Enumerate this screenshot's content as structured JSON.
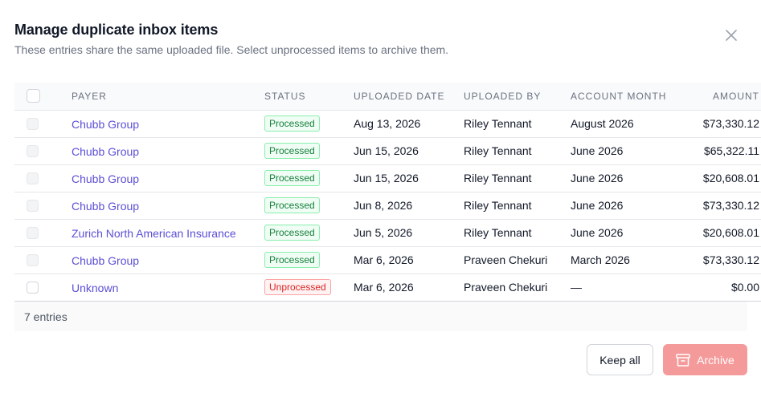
{
  "dialog": {
    "title": "Manage duplicate inbox items",
    "subtitle": "These entries share the same uploaded file. Select unprocessed items to archive them.",
    "close_icon": "close-icon"
  },
  "table": {
    "columns": [
      "PAYER",
      "STATUS",
      "UPLOADED DATE",
      "UPLOADED BY",
      "ACCOUNT MONTH",
      "AMOUNT"
    ],
    "rows": [
      {
        "payer": "Chubb Group",
        "status": "Processed",
        "status_type": "processed",
        "date": "Aug 13, 2026",
        "by": "Riley Tennant",
        "month": "August 2026",
        "amount": "$73,330.12"
      },
      {
        "payer": "Chubb Group",
        "status": "Processed",
        "status_type": "processed",
        "date": "Jun 15, 2026",
        "by": "Riley Tennant",
        "month": "June 2026",
        "amount": "$65,322.11"
      },
      {
        "payer": "Chubb Group",
        "status": "Processed",
        "status_type": "processed",
        "date": "Jun 15, 2026",
        "by": "Riley Tennant",
        "month": "June 2026",
        "amount": "$20,608.01"
      },
      {
        "payer": "Chubb Group",
        "status": "Processed",
        "status_type": "processed",
        "date": "Jun 8, 2026",
        "by": "Riley Tennant",
        "month": "June 2026",
        "amount": "$73,330.12"
      },
      {
        "payer": "Zurich North American Insurance",
        "status": "Processed",
        "status_type": "processed",
        "date": "Jun 5, 2026",
        "by": "Riley Tennant",
        "month": "June 2026",
        "amount": "$20,608.01"
      },
      {
        "payer": "Chubb Group",
        "status": "Processed",
        "status_type": "processed",
        "date": "Mar 6, 2026",
        "by": "Praveen Chekuri",
        "month": "March 2026",
        "amount": "$73,330.12"
      },
      {
        "payer": "Unknown",
        "status": "Unprocessed",
        "status_type": "unprocessed",
        "date": "Mar 6, 2026",
        "by": "Praveen Chekuri",
        "month": "—",
        "amount": "$0.00"
      }
    ],
    "footer": "7 entries"
  },
  "actions": {
    "keep_all": "Keep all",
    "archive": "Archive",
    "archive_icon": "archive-box-icon"
  },
  "colors": {
    "link": "#5b4fd6",
    "processed": "#15803d",
    "unprocessed": "#dc2626",
    "archive_button": "#f59a9a"
  }
}
